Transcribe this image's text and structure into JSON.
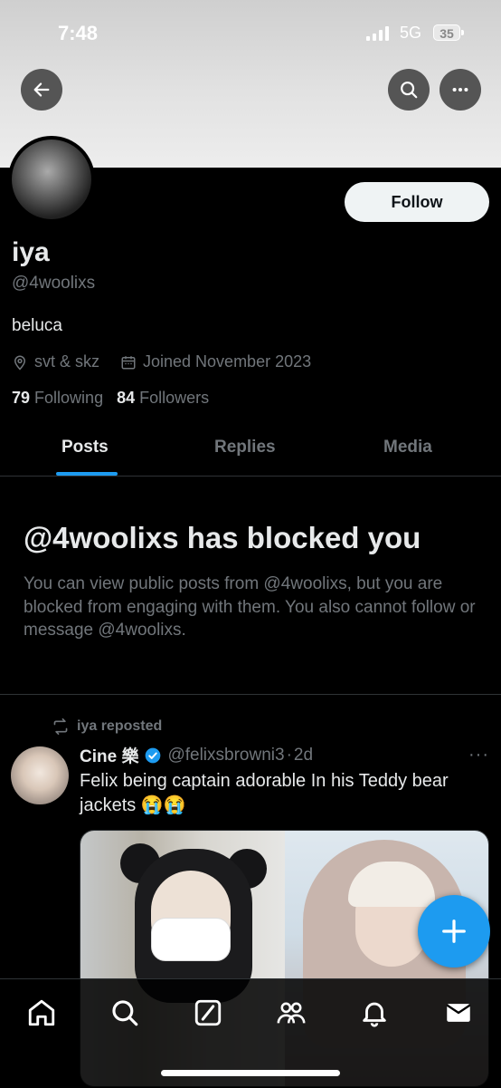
{
  "status_bar": {
    "time": "7:48",
    "network": "5G",
    "battery": "35"
  },
  "top_bar": {
    "back_icon": "arrow-left-icon",
    "search_icon": "search-icon",
    "more_icon": "more-horizontal-icon"
  },
  "profile": {
    "name": "iya",
    "handle": "@4woolixs",
    "bio": "beluca",
    "location": "svt & skz",
    "joined": "Joined November 2023",
    "following_count": "79",
    "following_label": "Following",
    "followers_count": "84",
    "followers_label": "Followers",
    "follow_label": "Follow"
  },
  "tabs": [
    {
      "label": "Posts",
      "active": true
    },
    {
      "label": "Replies",
      "active": false
    },
    {
      "label": "Media",
      "active": false
    }
  ],
  "blocked": {
    "title": "@4woolixs has blocked you",
    "text": "You can view public posts from @4woolixs, but you are blocked from engaging with them. You also cannot follow or message @4woolixs."
  },
  "post": {
    "repost_label": "iya reposted",
    "author_name": "Cine 樂",
    "author_handle": "@felixsbrowni3",
    "separator": "·",
    "time": "2d",
    "text": "Felix being captain adorable In his Teddy bear jackets 😭😭",
    "more": "···"
  },
  "fab": {
    "icon": "plus-icon"
  },
  "bottom_nav": [
    "home-icon",
    "search-icon",
    "grok-icon",
    "communities-icon",
    "notifications-icon",
    "messages-icon"
  ],
  "colors": {
    "accent": "#1d9bf0",
    "background": "#000000",
    "muted": "#71767b",
    "text": "#e7e9ea"
  }
}
